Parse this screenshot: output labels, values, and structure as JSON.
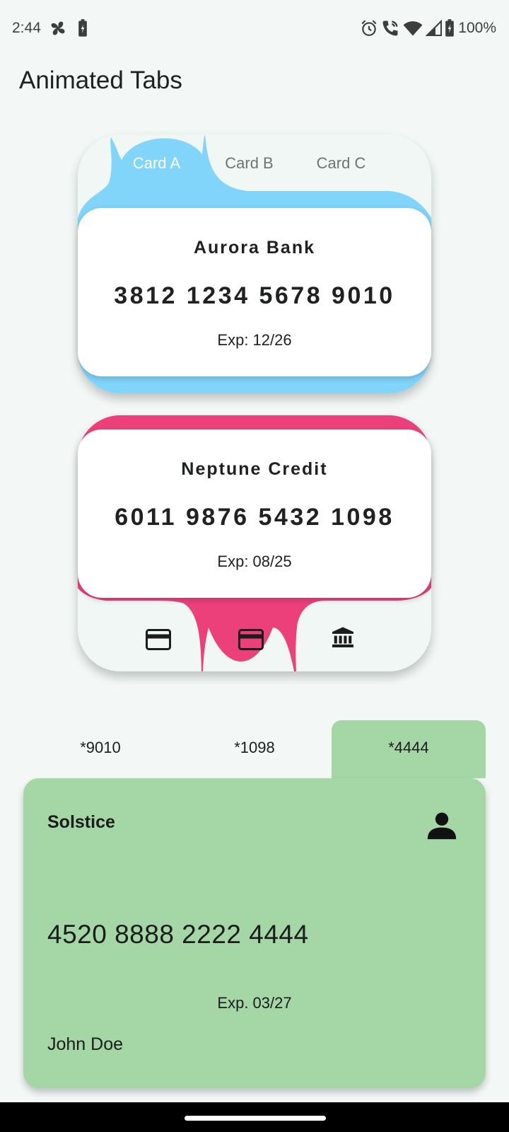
{
  "status_bar": {
    "time": "2:44",
    "battery_percent": "100%",
    "icons": [
      "fan-icon",
      "battery-saver-icon",
      "alarm-icon",
      "wifi-calling-icon",
      "wifi-icon",
      "signal-icon",
      "battery-icon"
    ]
  },
  "page_title": "Animated Tabs",
  "top_tabs": [
    {
      "label": "Card A",
      "active": true
    },
    {
      "label": "Card B",
      "active": false
    },
    {
      "label": "Card C",
      "active": false
    }
  ],
  "card_a": {
    "bank": "Aurora Bank",
    "number": "3812 1234 5678 9010",
    "expiry": "Exp: 12/26",
    "accent": "#81d4fa"
  },
  "card_b": {
    "bank": "Neptune Credit",
    "number": "6011 9876 5432 1098",
    "expiry": "Exp: 08/25",
    "accent": "#ec407a"
  },
  "bottom_tabs": [
    {
      "icon": "credit-card-icon",
      "active": false
    },
    {
      "icon": "credit-card-icon",
      "active": true
    },
    {
      "icon": "bank-icon",
      "active": false
    }
  ],
  "folder_tabs": [
    {
      "label": "*9010",
      "active": false
    },
    {
      "label": "*1098",
      "active": false
    },
    {
      "label": "*4444",
      "active": true
    }
  ],
  "solstice_card": {
    "issuer": "Solstice",
    "number": "4520 8888 2222 4444",
    "expiry": "Exp. 03/27",
    "holder": "John Doe",
    "color": "#a4d6a6",
    "icon": "person-icon"
  }
}
